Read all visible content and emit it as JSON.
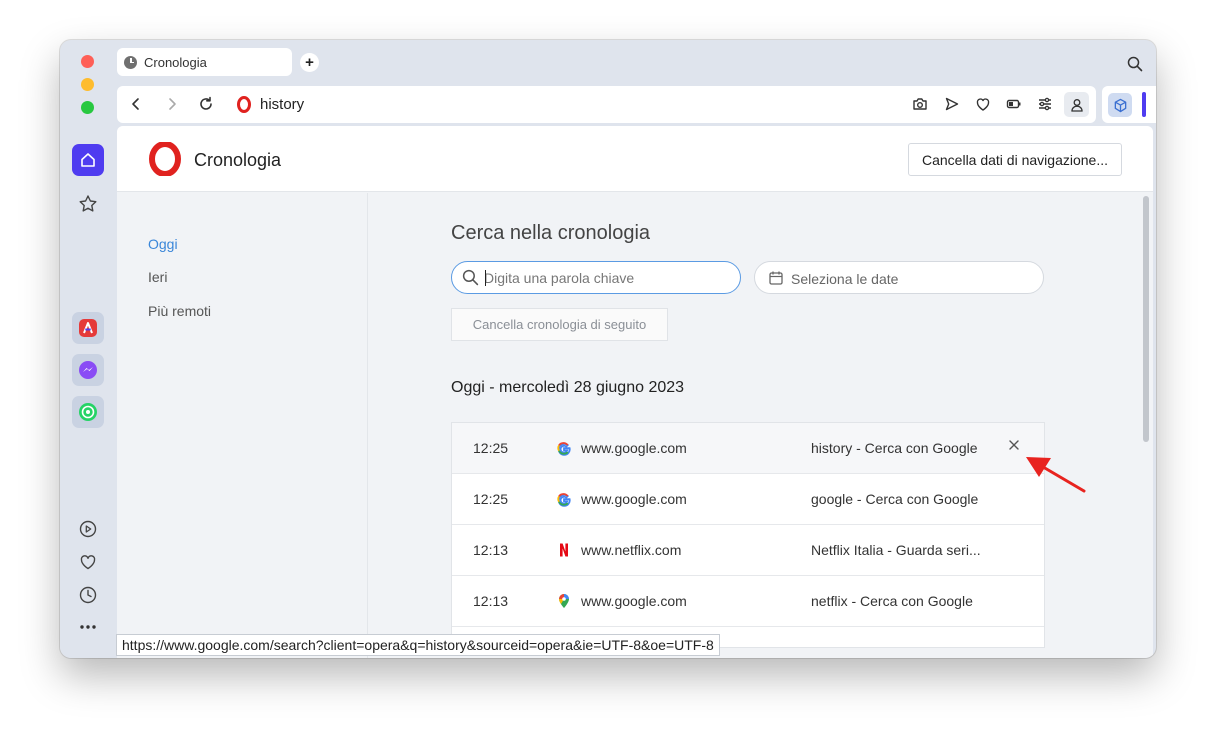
{
  "tab": {
    "title": "Cronologia",
    "new_tab": "+"
  },
  "address_bar": {
    "url": "history"
  },
  "page": {
    "title": "Cronologia",
    "clear_browsing_data": "Cancella dati di navigazione..."
  },
  "left_nav": {
    "items": [
      {
        "label": "Oggi",
        "active": true
      },
      {
        "label": "Ieri",
        "active": false
      },
      {
        "label": "Più remoti",
        "active": false
      }
    ]
  },
  "main": {
    "heading": "Cerca nella cronologia",
    "search": {
      "placeholder": "Digita una parola chiave",
      "value": ""
    },
    "date_picker": {
      "label": "Seleziona le date"
    },
    "clear_series": "Cancella cronologia di seguito",
    "date_heading": "Oggi - mercoledì 28 giugno 2023",
    "entries": [
      {
        "time": "12:25",
        "site": "www.google.com",
        "title": "history - Cerca con Google",
        "favicon": "google-icon"
      },
      {
        "time": "12:25",
        "site": "www.google.com",
        "title": "google - Cerca con Google",
        "favicon": "google-icon"
      },
      {
        "time": "12:13",
        "site": "www.netflix.com",
        "title": "Netflix Italia - Guarda seri...",
        "favicon": "netflix-icon"
      },
      {
        "time": "12:13",
        "site": "www.google.com",
        "title": "netflix - Cerca con Google",
        "favicon": "google-maps-icon"
      }
    ]
  },
  "status_bar": {
    "url": "https://www.google.com/search?client=opera&q=history&sourceid=opera&ie=UTF-8&oe=UTF-8"
  },
  "colors": {
    "accent": "#4f3cf0",
    "link_active": "#3a86d9",
    "opera_red": "#e0221f",
    "annotation_arrow": "#e8231f"
  }
}
